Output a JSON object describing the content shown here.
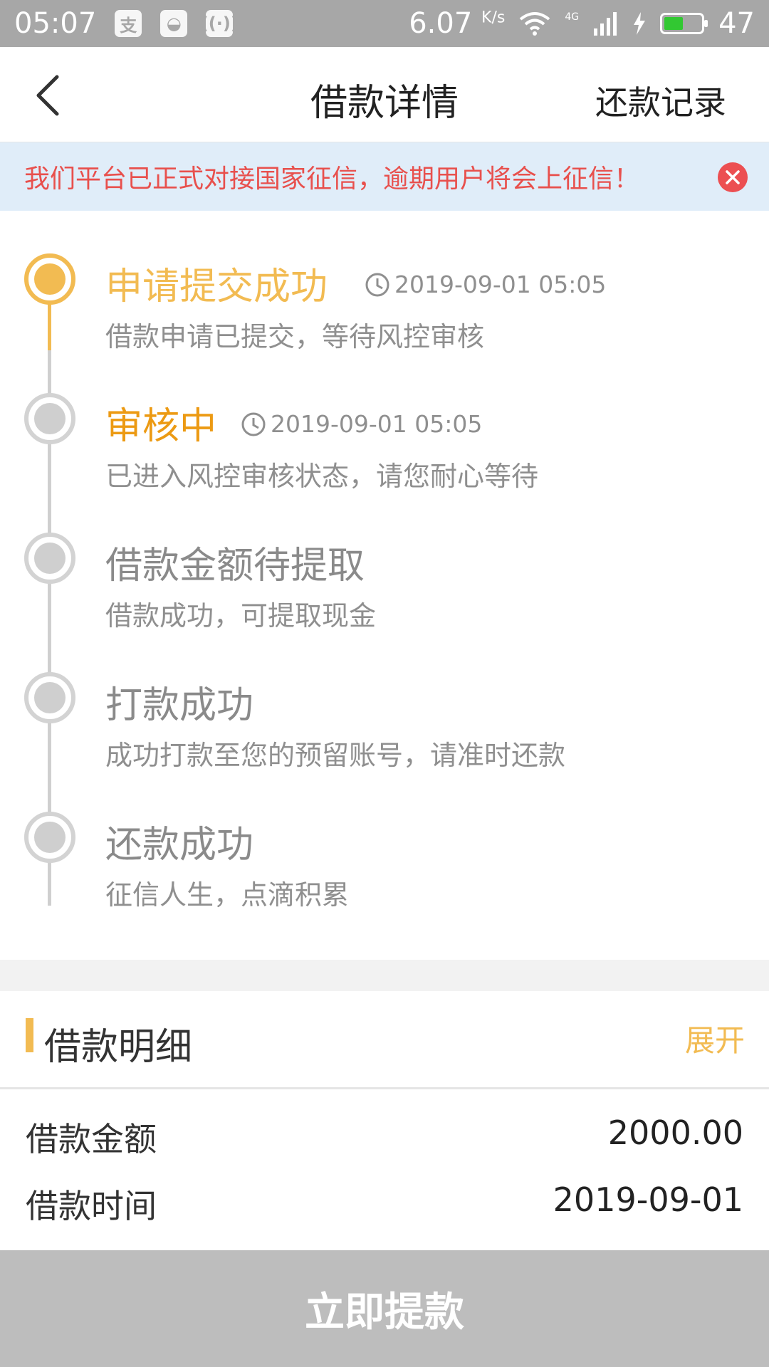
{
  "status_bar": {
    "time": "05:07",
    "speed": "6.07",
    "speed_unit": "K/s",
    "network": "4G",
    "battery": "47"
  },
  "nav": {
    "title": "借款详情",
    "action": "还款记录"
  },
  "notice": {
    "text": "我们平台已正式对接国家征信，逾期用户将会上征信！"
  },
  "timeline": {
    "steps": [
      {
        "title": "申请提交成功",
        "time": "2019-09-01 05:05",
        "desc": "借款申请已提交，等待风控审核",
        "state": "done"
      },
      {
        "title": "审核中",
        "time": "2019-09-01 05:05",
        "desc": "已进入风控审核状态，请您耐心等待",
        "state": "current"
      },
      {
        "title": "借款金额待提取",
        "time": "",
        "desc": "借款成功，可提取现金",
        "state": "pending"
      },
      {
        "title": "打款成功",
        "time": "",
        "desc": "成功打款至您的预留账号，请准时还款",
        "state": "pending"
      },
      {
        "title": "还款成功",
        "time": "",
        "desc": "征信人生，点滴积累",
        "state": "pending"
      }
    ]
  },
  "detail": {
    "title": "借款明细",
    "expand": "展开",
    "rows": [
      {
        "label": "借款金额",
        "value": "2000.00"
      },
      {
        "label": "借款时间",
        "value": "2019-09-01"
      }
    ]
  },
  "action_button": {
    "label": "立即提款"
  },
  "colors": {
    "accent": "#f2bb52",
    "current": "#ec9a13",
    "notice_bg": "#e0edf9",
    "notice_text": "#e8504d",
    "button_disabled": "#bdbdbd"
  }
}
